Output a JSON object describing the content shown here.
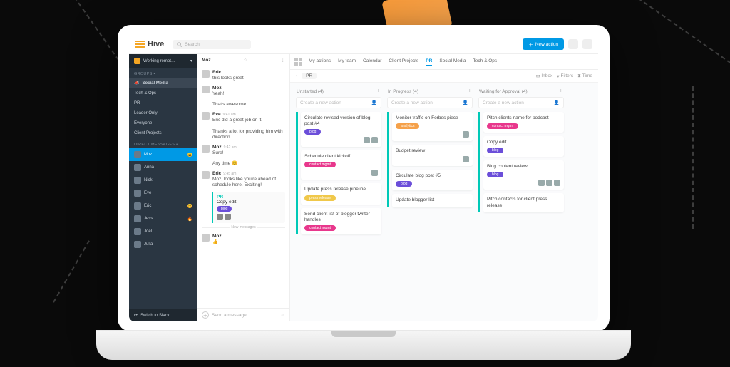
{
  "app": {
    "name": "Hive"
  },
  "search": {
    "placeholder": "Search"
  },
  "newAction": {
    "label": "New action"
  },
  "workspace": {
    "name": "Working remot…",
    "foot": "Switch to Slack"
  },
  "sidebar": {
    "groupsHead": "GROUPS  •",
    "items": [
      {
        "label": "Social Media",
        "active": true,
        "emoji": "📣"
      },
      {
        "label": "Tech & Ops"
      },
      {
        "label": "PR"
      },
      {
        "label": "Leader Only"
      },
      {
        "label": "Everyone"
      },
      {
        "label": "Client Projects"
      }
    ],
    "dmHead": "DIRECT MESSAGES  •",
    "dms": [
      {
        "label": "Moz",
        "active": true,
        "emoji": "😄"
      },
      {
        "label": "Anna"
      },
      {
        "label": "Nick"
      },
      {
        "label": "Eve",
        "emoji": ""
      },
      {
        "label": "Eric",
        "emoji": "😊"
      },
      {
        "label": "Jess",
        "emoji": "🔥"
      },
      {
        "label": "Joel"
      },
      {
        "label": "Julia"
      }
    ]
  },
  "chat": {
    "header": "Moz",
    "messages": [
      {
        "name": "Eric",
        "time": "",
        "body": "this looks great"
      },
      {
        "name": "Moz",
        "time": "",
        "body": "Yeah!"
      },
      {
        "name": "",
        "time": "",
        "body": "That's awesome"
      },
      {
        "name": "Eve",
        "time": "9:41 am",
        "body": "Eric did a great job on it."
      },
      {
        "name": "",
        "time": "",
        "body": "Thanks a lot for providing him with direction"
      },
      {
        "name": "Moz",
        "time": "9:42 am",
        "body": "Sure!"
      },
      {
        "name": "",
        "time": "",
        "body": "Any time 😊"
      },
      {
        "name": "Eric",
        "time": "9:45 am",
        "body": "Moz, looks like you're ahead of schedule here. Exciting!"
      }
    ],
    "cardTitle": "PR",
    "cardSub": "Copy edit",
    "cardTag": "blog",
    "dividerLabel": "New messages",
    "msg2": {
      "name": "Moz",
      "time": "",
      "body": "👍"
    },
    "composer": "Send a message"
  },
  "tabs": [
    "My actions",
    "My team",
    "Calendar",
    "Client Projects",
    "PR",
    "Social Media",
    "Tech & Ops"
  ],
  "crumb": {
    "name": "PR",
    "inbox": "Inbox",
    "filters": "Filters",
    "time": "Time"
  },
  "columns": [
    {
      "title": "Unstarted (4)",
      "add": "Create a new action",
      "cards": [
        {
          "t": "Circulate revised version of blog post #4",
          "tag": "blog",
          "c": "purple",
          "av": 2
        },
        {
          "t": "Schedule client kickoff",
          "tag": "contact mgmt",
          "c": "pink",
          "av": 1
        },
        {
          "t": "Update press release pipeline",
          "tag": "press release",
          "c": "yellow",
          "av": 0
        },
        {
          "t": "Send client list of blogger twitter handles",
          "tag": "contact mgmt",
          "c": "pink",
          "av": 0
        }
      ]
    },
    {
      "title": "In Progress (4)",
      "add": "Create a new action",
      "cards": [
        {
          "t": "Monitor traffic on Forbes piece",
          "tag": "analytics",
          "c": "orange",
          "av": 1
        },
        {
          "t": "Budget review",
          "tag": "",
          "c": "",
          "av": 1
        },
        {
          "t": "Circulate blog post #5",
          "tag": "blog",
          "c": "purple",
          "av": 0
        },
        {
          "t": "Update blogger list",
          "tag": "",
          "c": "",
          "av": 0
        }
      ]
    },
    {
      "title": "Waiting for Approval (4)",
      "add": "Create a new action",
      "cards": [
        {
          "t": "Pitch clients name for podcast",
          "tag": "contact mgmt",
          "c": "pink",
          "av": 0
        },
        {
          "t": "Copy edit",
          "tag": "blog",
          "c": "purple",
          "av": 0
        },
        {
          "t": "Blog content review",
          "tag": "blog",
          "c": "purple",
          "av": 3
        },
        {
          "t": "Pitch contacts for client press release",
          "tag": "",
          "c": "",
          "av": 0
        }
      ]
    }
  ]
}
